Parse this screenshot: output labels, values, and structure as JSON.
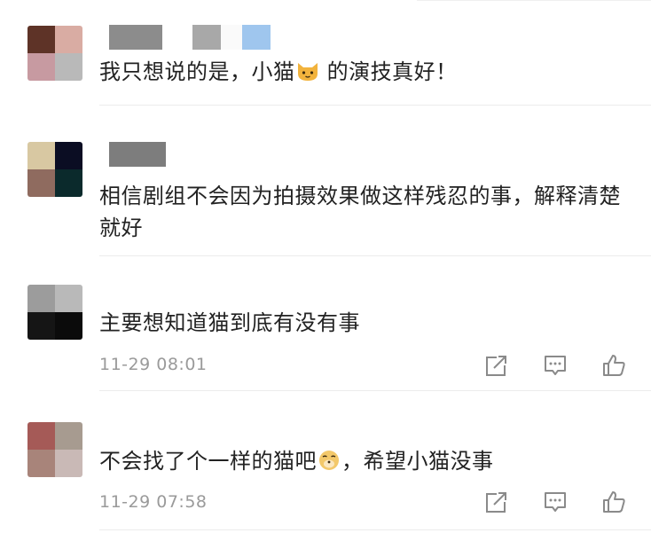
{
  "comments": [
    {
      "text_before": "我只想说的是，小猫",
      "emoji": "cat-face-emoji",
      "text_after": "的演技真好！",
      "avatar_colors": [
        "#5e3327",
        "#d9aca3",
        "#c79aa1",
        "#b9b9b9"
      ],
      "name_blocks": [
        "#888888",
        "#aaaaaa",
        "#98c4ef"
      ]
    },
    {
      "text": "相信剧组不会因为拍摄效果做这样残忍的事，解释清楚就好",
      "avatar_colors": [
        "#d8c8a2",
        "#0b0d23",
        "#8f6b5f",
        "#0b2a2c"
      ],
      "name_blocks": [
        "#7d7d7d"
      ]
    },
    {
      "text": "主要想知道猫到底有没有事",
      "time": "11-29 08:01",
      "avatar_colors": [
        "#9c9c9c",
        "#b9b9b9",
        "#151515",
        "#0b0b0b"
      ]
    },
    {
      "text_before": "不会找了个一样的猫吧",
      "emoji": "doge-face-emoji",
      "text_after": "，希望小猫没事",
      "time": "11-29 07:58",
      "avatar_colors": [
        "#a55a57",
        "#a79b90",
        "#a8847a",
        "#c9b9b6"
      ]
    }
  ],
  "icons": {
    "share": "share-icon",
    "comment": "comment-icon",
    "like": "like-icon"
  }
}
